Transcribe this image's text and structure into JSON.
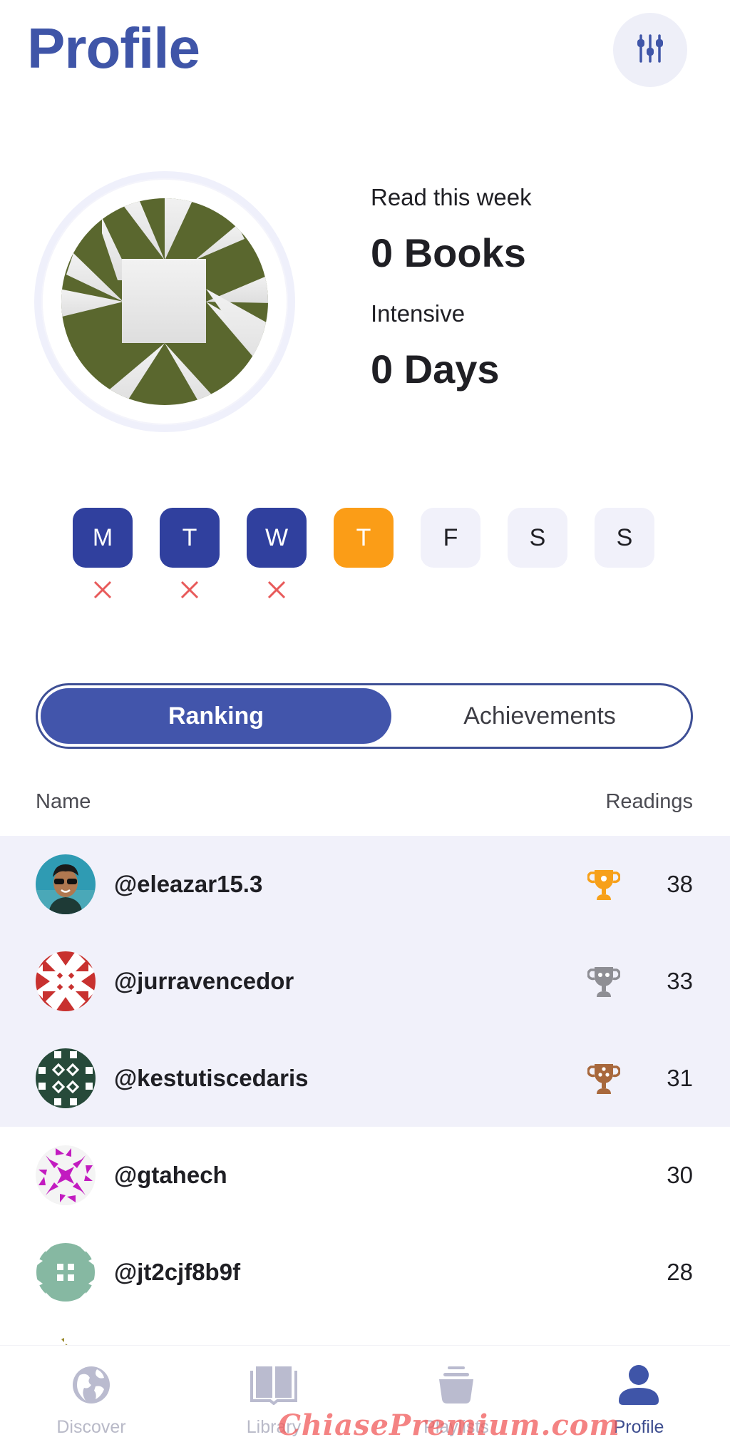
{
  "header": {
    "title": "Profile",
    "filter_button_icon": "sliders-icon"
  },
  "stats": {
    "read_label": "Read this week",
    "read_value": "0 Books",
    "intensive_label": "Intensive",
    "intensive_value": "0 Days"
  },
  "week": {
    "days": [
      {
        "letter": "M",
        "state": "done",
        "mark": "x"
      },
      {
        "letter": "T",
        "state": "done",
        "mark": "x"
      },
      {
        "letter": "W",
        "state": "done",
        "mark": "x"
      },
      {
        "letter": "T",
        "state": "today",
        "mark": ""
      },
      {
        "letter": "F",
        "state": "future",
        "mark": ""
      },
      {
        "letter": "S",
        "state": "future",
        "mark": ""
      },
      {
        "letter": "S",
        "state": "future",
        "mark": ""
      }
    ],
    "colors": {
      "done": "#30409e",
      "today": "#fb9d17",
      "future": "#f1f1fa",
      "miss_mark": "#e85a5a"
    }
  },
  "segment": {
    "tabs": [
      {
        "label": "Ranking",
        "active": true
      },
      {
        "label": "Achievements",
        "active": false
      }
    ]
  },
  "ranking": {
    "col_name": "Name",
    "col_readings": "Readings",
    "rows": [
      {
        "username": "@eleazar15.3",
        "readings": "38",
        "trophy": "gold"
      },
      {
        "username": "@jurravencedor",
        "readings": "33",
        "trophy": "silver"
      },
      {
        "username": "@kestutiscedaris",
        "readings": "31",
        "trophy": "bronze"
      },
      {
        "username": "@gtahech",
        "readings": "30",
        "trophy": ""
      },
      {
        "username": "@jt2cjf8b9f",
        "readings": "28",
        "trophy": ""
      }
    ],
    "trophy_colors": {
      "gold": "#f7a01a",
      "silver": "#8e8e94",
      "bronze": "#a8683c"
    }
  },
  "navbar": {
    "items": [
      {
        "label": "Discover",
        "icon": "globe-icon",
        "active": false
      },
      {
        "label": "Library",
        "icon": "book-icon",
        "active": false
      },
      {
        "label": "Playlists",
        "icon": "stack-icon",
        "active": false
      },
      {
        "label": "Profile",
        "icon": "person-icon",
        "active": true
      }
    ],
    "inactive_color": "#babbcf",
    "active_color": "#3f55a8"
  },
  "watermark": "ChiasePremium.com"
}
